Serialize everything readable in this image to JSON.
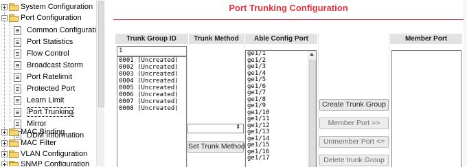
{
  "tree": {
    "items": [
      {
        "label": "System Configuration",
        "type": "folder",
        "expander": "plus"
      },
      {
        "label": "Port Configuration",
        "type": "folder",
        "expander": "minus"
      },
      {
        "label": "Common Configuration",
        "type": "page"
      },
      {
        "label": "Port Statistics",
        "type": "page"
      },
      {
        "label": "Flow Control",
        "type": "page"
      },
      {
        "label": "Broadcast Storm",
        "type": "page"
      },
      {
        "label": "Port Ratelimit",
        "type": "page"
      },
      {
        "label": "Protected Port",
        "type": "page"
      },
      {
        "label": "Learn Limit",
        "type": "page"
      },
      {
        "label": "Port Trunking",
        "type": "page",
        "selected": true
      },
      {
        "label": "Mirror",
        "type": "page"
      },
      {
        "label": "DDM Information",
        "type": "page"
      },
      {
        "label": "MAC Binding",
        "type": "folder",
        "expander": "plus"
      },
      {
        "label": "MAC Filter",
        "type": "folder",
        "expander": "plus"
      },
      {
        "label": "VLAN Configuration",
        "type": "folder",
        "expander": "plus"
      },
      {
        "label": "SNMP Configuration",
        "type": "folder",
        "expander": "plus"
      }
    ]
  },
  "page": {
    "title": "Port Trunking Configuration",
    "title_color": "#e5323c"
  },
  "columns": {
    "trunk_group_id": "Trunk Group ID",
    "trunk_method": "Trunk Method",
    "able_config_port": "Able Config Port",
    "member_port": "Member Port"
  },
  "trunk_group": {
    "input_value": "1",
    "list": [
      "0001 (Uncreated)",
      "0002 (Uncreated)",
      "0003 (Uncreated)",
      "0004 (Uncreated)",
      "0005 (Uncreated)",
      "0006 (Uncreated)",
      "0007 (Uncreated)",
      "0008 (Uncreated)"
    ]
  },
  "trunk_method": {
    "selected": "",
    "set_button": "Set Trunk Method"
  },
  "able_ports": [
    "ge1/1",
    "ge1/2",
    "ge1/3",
    "ge1/4",
    "ge1/5",
    "ge1/6",
    "ge1/7",
    "ge1/8",
    "ge1/9",
    "ge1/10",
    "ge1/11",
    "ge1/12",
    "ge1/13",
    "ge1/14",
    "ge1/15",
    "ge1/16",
    "ge1/17"
  ],
  "member_ports": [],
  "buttons": {
    "create": "Create Trunk Group",
    "member": "Member Port =>",
    "unmember": "Unmember Port <=",
    "delete": "Delete trunk Group"
  }
}
